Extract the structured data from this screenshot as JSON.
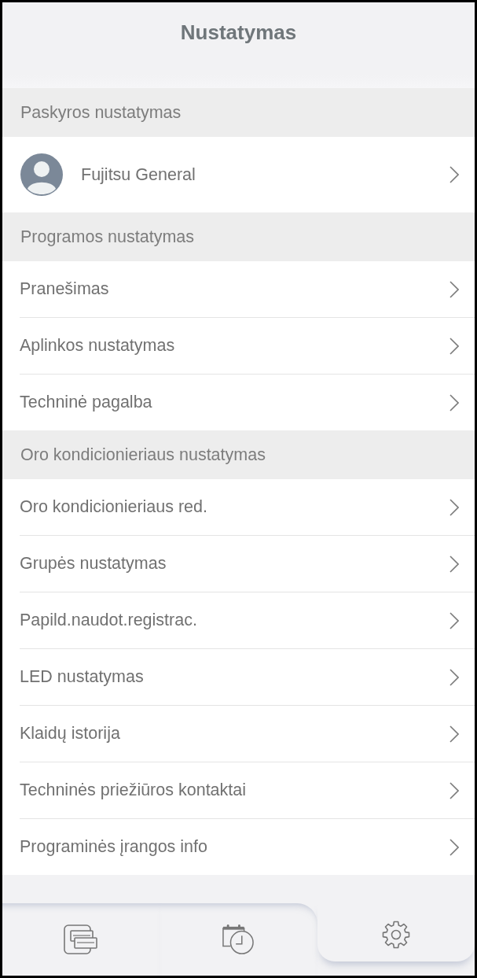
{
  "header": {
    "title": "Nustatymas"
  },
  "sections": [
    {
      "title": "Paskyros nustatymas",
      "items": [
        {
          "kind": "account",
          "label": "Fujitsu General"
        }
      ]
    },
    {
      "title": "Programos nustatymas",
      "items": [
        {
          "kind": "link",
          "label": "Pranešimas"
        },
        {
          "kind": "link",
          "label": "Aplinkos nustatymas"
        },
        {
          "kind": "link",
          "label": "Techninė pagalba"
        }
      ]
    },
    {
      "title": "Oro kondicionieriaus nustatymas",
      "items": [
        {
          "kind": "link",
          "label": "Oro kondicionieriaus red."
        },
        {
          "kind": "link",
          "label": "Grupės nustatymas"
        },
        {
          "kind": "link",
          "label": "Papild.naudot.registrac."
        },
        {
          "kind": "link",
          "label": "LED nustatymas"
        },
        {
          "kind": "link",
          "label": "Klaidų istorija"
        },
        {
          "kind": "link",
          "label": "Techninės priežiūros kontaktai"
        },
        {
          "kind": "link",
          "label": "Programinės įrangos info"
        }
      ]
    }
  ],
  "tab_bar": {
    "tabs": [
      {
        "selected": false
      },
      {
        "selected": false
      },
      {
        "selected": true
      }
    ]
  }
}
